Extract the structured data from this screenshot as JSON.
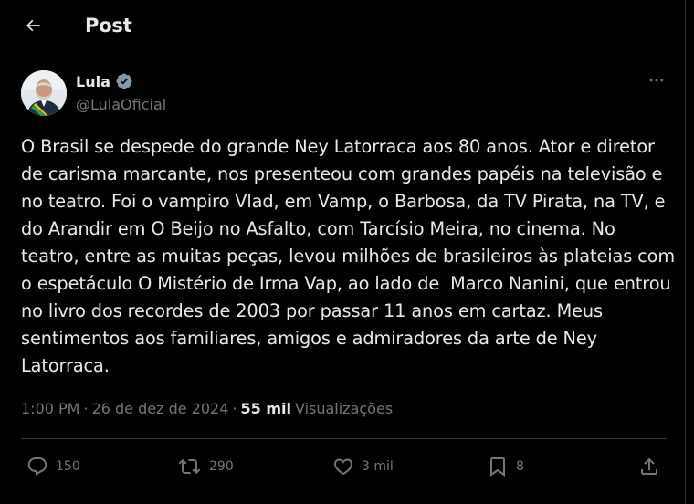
{
  "header": {
    "back_icon": "arrow-left-icon",
    "title": "Post"
  },
  "author": {
    "display_name": "Lula",
    "verified_icon": "verified-badge-icon",
    "verified_color": "#829aab",
    "handle": "@LulaOficial",
    "more_icon": "more-horizontal-icon"
  },
  "post": {
    "text": "O Brasil se despede do grande Ney Latorraca aos 80 anos. Ator e diretor de carisma marcante, nos presenteou com grandes papéis na televisão e no teatro. Foi o vampiro Vlad, em Vamp, o Barbosa, da TV Pirata, na TV, e do Arandir em O Beijo no Asfalto, com Tarcísio Meira, no cinema. No teatro, entre as muitas peças, levou milhões de brasileiros às plateias com o espetáculo O Mistério de Irma Vap, ao lado de  Marco Nanini, que entrou no livro dos recordes de 2003 por passar 11 anos em cartaz. Meus sentimentos aos familiares, amigos e admiradores da arte de Ney Latorraca."
  },
  "meta": {
    "time": "1:00 PM",
    "separator": "·",
    "date": "26 de dez de 2024",
    "views_count": "55 mil",
    "views_label": "Visualizações"
  },
  "actions": {
    "reply": {
      "icon": "reply-icon",
      "count": "150"
    },
    "repost": {
      "icon": "repost-icon",
      "count": "290"
    },
    "like": {
      "icon": "heart-icon",
      "count": "3 mil"
    },
    "bookmark": {
      "icon": "bookmark-icon",
      "count": "8"
    },
    "share": {
      "icon": "share-icon"
    }
  },
  "colors": {
    "background": "#000000",
    "text_primary": "#e7e9ea",
    "text_secondary": "#71767b",
    "border": "#2f3336"
  }
}
